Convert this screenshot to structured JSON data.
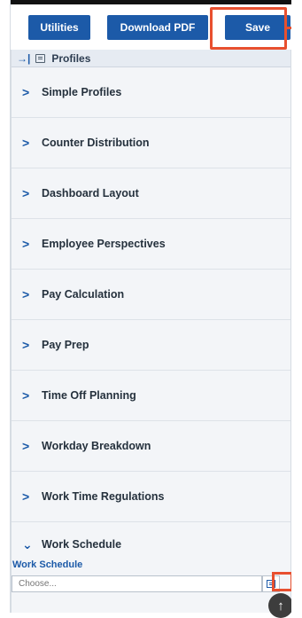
{
  "toolbar": {
    "utilities_label": "Utilities",
    "download_pdf_label": "Download PDF",
    "save_label": "Save"
  },
  "panel": {
    "title": "Profiles",
    "collapse_icon": "collapse-right-icon",
    "title_icon": "profiles-icon"
  },
  "sections": [
    {
      "label": "Simple Profiles",
      "expanded": false
    },
    {
      "label": "Counter Distribution",
      "expanded": false
    },
    {
      "label": "Dashboard Layout",
      "expanded": false
    },
    {
      "label": "Employee Perspectives",
      "expanded": false
    },
    {
      "label": "Pay Calculation",
      "expanded": false
    },
    {
      "label": "Pay Prep",
      "expanded": false
    },
    {
      "label": "Time Off Planning",
      "expanded": false
    },
    {
      "label": "Workday Breakdown",
      "expanded": false
    },
    {
      "label": "Work Time Regulations",
      "expanded": false
    },
    {
      "label": "Work Schedule",
      "expanded": true
    }
  ],
  "work_schedule": {
    "field_label": "Work Schedule",
    "placeholder": "Choose...",
    "value": ""
  },
  "colors": {
    "accent": "#1c5aa8",
    "highlight": "#e8502f"
  },
  "icons": {
    "collapsed_section": "chevron-right-icon",
    "expanded_section": "chevron-down-icon",
    "lookup": "lookup-icon",
    "scroll_top": "arrow-up-icon"
  }
}
